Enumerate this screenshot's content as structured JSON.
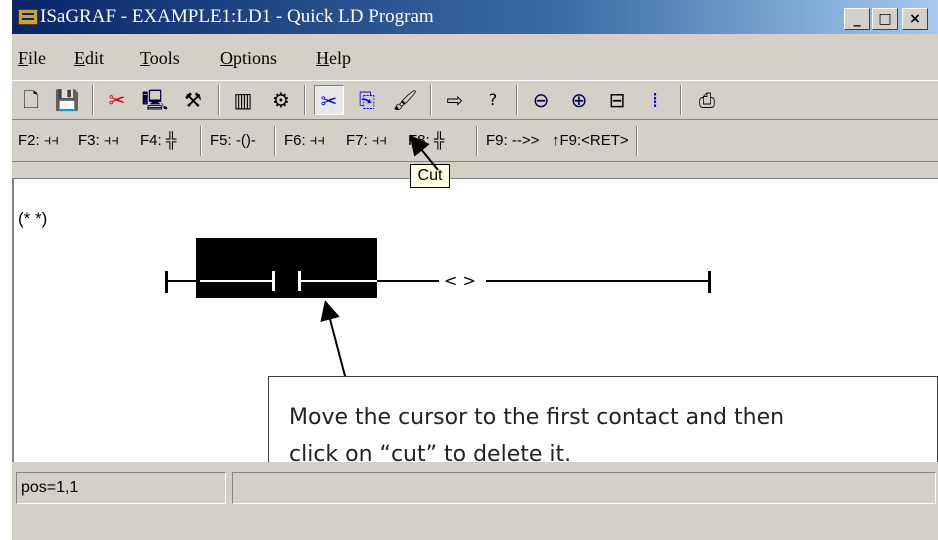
{
  "window": {
    "title": "ISaGRAF - EXAMPLE1:LD1 - Quick LD Program",
    "controls": {
      "minimize": "_",
      "maximize": "□",
      "close": "×"
    }
  },
  "menu": {
    "items": [
      {
        "first": "F",
        "rest": "ile"
      },
      {
        "first": "E",
        "rest": "dit"
      },
      {
        "first": "T",
        "rest": "ools"
      },
      {
        "first": "O",
        "rest": "ptions"
      },
      {
        "first": "H",
        "rest": "elp"
      }
    ]
  },
  "toolbar": {
    "icons": {
      "new": "🗋",
      "save": "💾",
      "cut_x": "✂",
      "monitor": "🖳",
      "run": "⚒",
      "book": "▥",
      "gear": "⚙",
      "cut": "✂",
      "copy": "⎘",
      "paste": "🖌",
      "goto": "⇨",
      "help": "?",
      "zoom_out": "⊖",
      "zoom_in": "⊕",
      "fit": "⊟",
      "grid": "⁞",
      "print": "⎙"
    },
    "tooltip": "Cut"
  },
  "fkeys": {
    "f2": "F2: ⫞⫞",
    "f3": "F3: ⫞⫞",
    "f4": "F4: ╬",
    "f5": "F5: -()-",
    "f6": "F6: ⫞⫞",
    "f7": "F7: ⫞⫞",
    "f8": "F8: ╬",
    "f9": "F9: -->>",
    "sf9": "↑F9:<RET>"
  },
  "editor": {
    "comment": "(* *)",
    "coil": "< >"
  },
  "callout": {
    "line1": "Move the cursor to the first contact and then",
    "line2": "click on “cut” to delete it."
  },
  "status": {
    "position": "pos=1,1"
  }
}
